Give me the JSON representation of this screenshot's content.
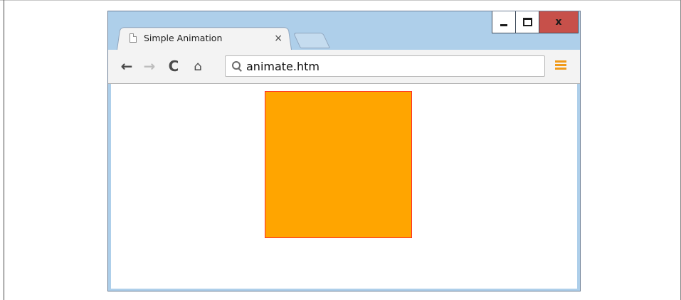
{
  "window": {
    "controls": {
      "minimize": "▁",
      "maximize": "□",
      "close": "x"
    }
  },
  "tab": {
    "title": "Simple Animation",
    "close": "×",
    "icon": "page-icon"
  },
  "toolbar": {
    "back": "←",
    "forward": "→",
    "reload": "C",
    "home": "⌂",
    "url": "animate.htm",
    "menu_icon": "hamburger-menu-icon",
    "accent": "#f09a1a"
  },
  "content": {
    "box": {
      "fill": "#ffa500",
      "border": "#ff2a2a"
    }
  }
}
